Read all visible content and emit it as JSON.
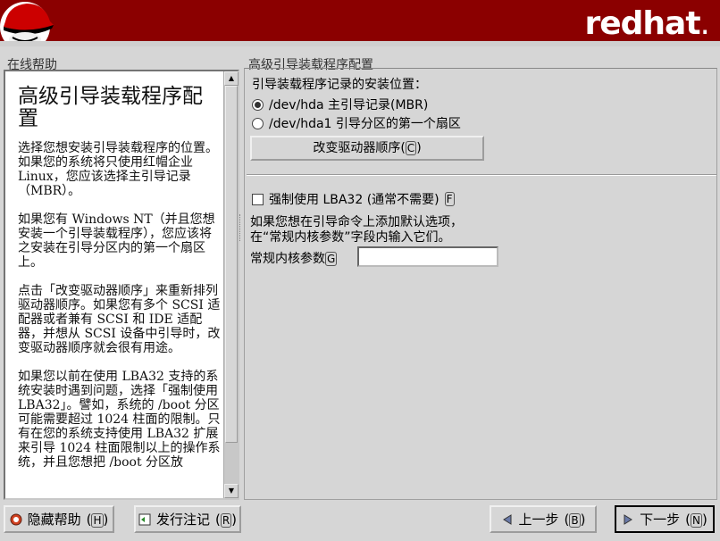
{
  "header": {
    "brand_main": "redhat",
    "brand_dot": "."
  },
  "help": {
    "group_label": "在线帮助",
    "title": "高级引导装载程序配置",
    "paragraphs": [
      "选择您想安装引导装载程序的位置。如果您的系统将只使用红帽企业 Linux，您应该选择主引导记录（MBR）。",
      "如果您有 Windows NT（并且您想安装一个引导装载程序），您应该将之安装在引导分区内的第一个扇区上。",
      "点击「改变驱动器顺序」来重新排列驱动器顺序。如果您有多个 SCSI 适配器或者兼有 SCSI 和 IDE 适配器，并想从 SCSI 设备中引导时，改变驱动器顺序就会很有用途。",
      "如果您以前在使用 LBA32 支持的系统安装时遇到问题，选择「强制使用 LBA32」。譬如，系统的 /boot 分区可能需要超过 1024 柱面的限制。只有在您的系统支持使用 LBA32 扩展来引导 1024 柱面限制以上的操作系统，并且您想把 /boot 分区放"
    ]
  },
  "config": {
    "group_label": "高级引导装载程序配置",
    "location_label": "引导装载程序记录的安装位置：",
    "options": [
      {
        "label": "/dev/hda 主引导记录(MBR)",
        "selected": true
      },
      {
        "label": "/dev/hda1 引导分区的第一个扇区",
        "selected": false
      }
    ],
    "drive_order_label": "改变驱动器顺序",
    "drive_order_key": "C",
    "lba32_label": "强制使用 LBA32 (通常不需要)",
    "lba32_key": "F",
    "lba32_checked": false,
    "kernel_desc_line1": "如果您想在引导命令上添加默认选项，",
    "kernel_desc_line2": "在“常规内核参数”字段内输入它们。",
    "kernel_label": "常规内核参数",
    "kernel_key": "G",
    "kernel_value": ""
  },
  "footer": {
    "hide_help": {
      "label": "隐藏帮助",
      "key": "H",
      "icon": "hide-help-icon"
    },
    "release_notes": {
      "label": "发行注记",
      "key": "R",
      "icon": "release-notes-icon"
    },
    "back": {
      "label": "上一步",
      "key": "B",
      "icon": "left-arrow-icon"
    },
    "next": {
      "label": "下一步",
      "key": "N",
      "icon": "right-arrow-icon"
    }
  }
}
